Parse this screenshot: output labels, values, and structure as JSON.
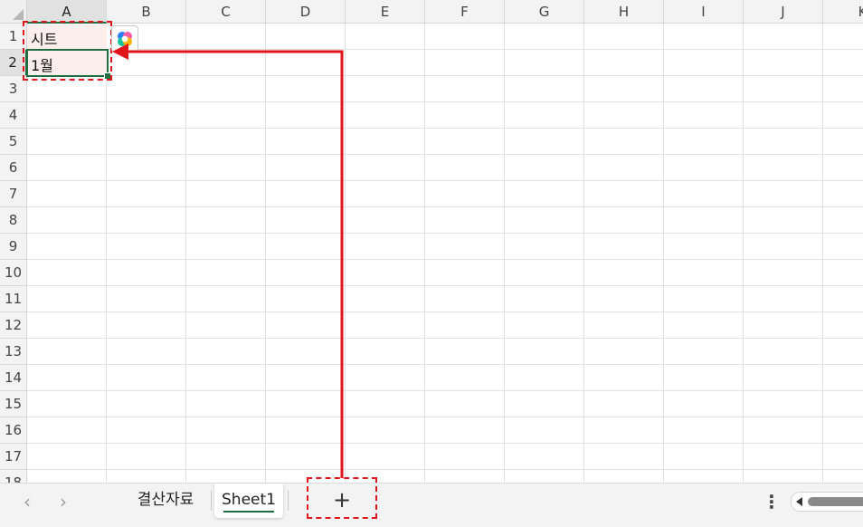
{
  "columns": [
    "A",
    "B",
    "C",
    "D",
    "E",
    "F",
    "G",
    "H",
    "I",
    "J",
    "K"
  ],
  "rows": [
    "1",
    "2",
    "3",
    "4",
    "5",
    "6",
    "7",
    "8",
    "9",
    "10",
    "11",
    "12",
    "13",
    "14",
    "15",
    "16",
    "17",
    "18"
  ],
  "selected": {
    "column": "A",
    "row": "2"
  },
  "cells": {
    "A1": "시트",
    "A2": "1월"
  },
  "tabs": {
    "prev_icon": "‹",
    "next_icon": "›",
    "items": [
      {
        "label": "결산자료",
        "active": false
      },
      {
        "label": "Sheet1",
        "active": true
      }
    ],
    "add_icon": "+",
    "more_icon": "⋮"
  },
  "annotation": {
    "color": "#e0161b"
  },
  "icons": {
    "copilot": "copilot-icon",
    "select_all": "select-all-icon",
    "scroll_left": "scroll-left-icon"
  },
  "colors": {
    "accent": "#1e6e42",
    "highlight": "#fdeeee",
    "annotation": "#e0161b"
  }
}
